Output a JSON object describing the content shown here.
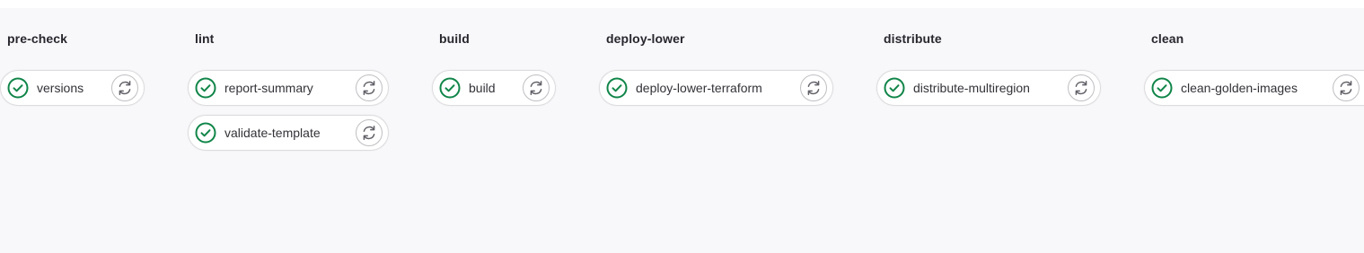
{
  "pipeline": {
    "stages": [
      {
        "name": "pre-check",
        "jobs": [
          {
            "name": "versions",
            "status": "success",
            "status_icon": "check-circle-icon",
            "action_icon": "retry-icon"
          }
        ]
      },
      {
        "name": "lint",
        "jobs": [
          {
            "name": "report-summary",
            "status": "success",
            "status_icon": "check-circle-icon",
            "action_icon": "retry-icon"
          },
          {
            "name": "validate-template",
            "status": "success",
            "status_icon": "check-circle-icon",
            "action_icon": "retry-icon"
          }
        ]
      },
      {
        "name": "build",
        "jobs": [
          {
            "name": "build",
            "status": "success",
            "status_icon": "check-circle-icon",
            "action_icon": "retry-icon"
          }
        ]
      },
      {
        "name": "deploy-lower",
        "jobs": [
          {
            "name": "deploy-lower-terraform",
            "status": "success",
            "status_icon": "check-circle-icon",
            "action_icon": "retry-icon"
          }
        ]
      },
      {
        "name": "distribute",
        "jobs": [
          {
            "name": "distribute-multiregion",
            "status": "success",
            "status_icon": "check-circle-icon",
            "action_icon": "retry-icon"
          }
        ]
      },
      {
        "name": "clean",
        "jobs": [
          {
            "name": "clean-golden-images",
            "status": "success",
            "status_icon": "check-circle-icon",
            "action_icon": "retry-icon"
          }
        ]
      }
    ]
  },
  "colors": {
    "success": "#108548",
    "background": "#f8f8fb",
    "border": "#dcdcde",
    "text": "#333238",
    "retry_icon": "#626168"
  }
}
